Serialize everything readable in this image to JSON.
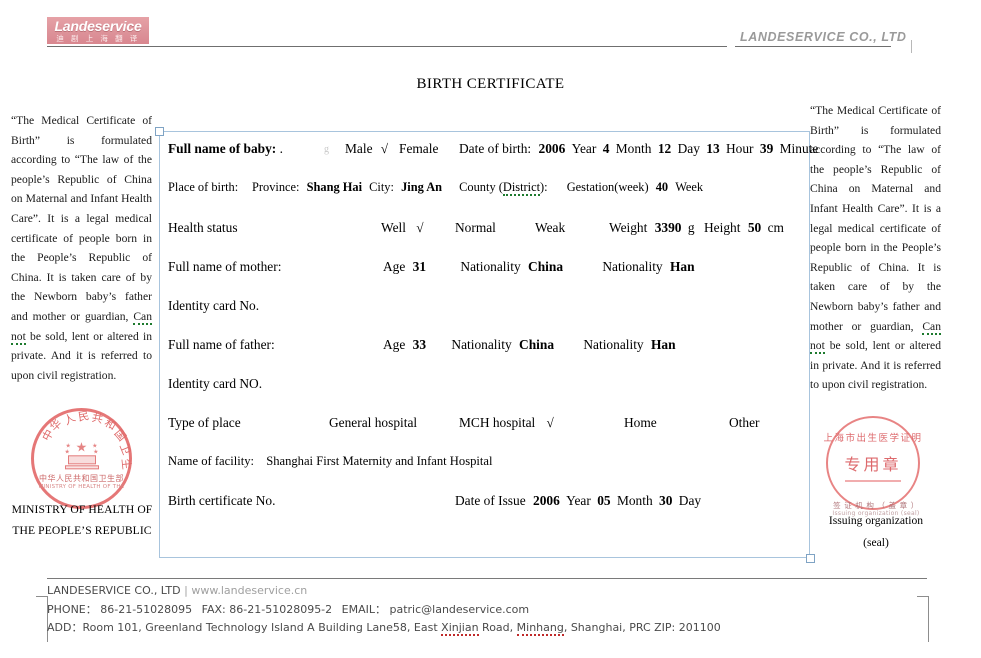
{
  "header": {
    "logo_main": "Landeservice",
    "logo_sub": "迪 剧 上 海 翻 译",
    "brand_right": "LANDESERVICE CO., LTD"
  },
  "title": "BIRTH CERTIFICATE",
  "side_text": {
    "left": "“The Medical Certificate of Birth” is formulated according to “The law of the people’s Republic of China on Maternal and Infant Health Care”. It is a legal medical certificate of people born in the People’s Republic of China. It is taken care of by the Newborn baby’s father and mother or guardian, ",
    "left_error_word": "Can not",
    "left_tail": " be sold, lent or altered in private. And it is referred to upon civil registration.",
    "right": "“The Medical Certificate of Birth” is formulated according to “The law of the people’s Republic of China on Maternal and Infant Health Care”. It is a legal medical certificate of people born in the People’s Republic of China. It is taken care of by the Newborn baby’s father and mother or guardian, ",
    "right_error_word": "Can not",
    "right_tail": " be sold, lent or altered in private. And it is referred to upon civil registration."
  },
  "form": {
    "baby_name_label": "Full name of baby:",
    "baby_name_value": ".",
    "weight_unit_inline": "g",
    "sex_male": "Male",
    "sex_male_checked": "√",
    "sex_female": "Female",
    "dob_label": "Date of birth:",
    "dob_year": "2006",
    "dob_year_unit": "Year",
    "dob_month": "4",
    "dob_month_unit": "Month",
    "dob_day": "12",
    "dob_day_unit": "Day",
    "dob_hour": "13",
    "dob_hour_unit": "Hour",
    "dob_minute": "39",
    "dob_minute_unit": "Minute",
    "place_of_birth_label": "Place of birth:",
    "province_label": "Province:",
    "province_value": "Shang Hai",
    "city_label": "City:",
    "city_value": "Jing An",
    "county_label": "County (",
    "county_error_word": "District",
    "county_label_end": "):",
    "gestation_label": "Gestation(week)",
    "gestation_value": "40",
    "gestation_unit": "Week",
    "health_status_label": "Health status",
    "health_well": "Well",
    "health_well_checked": "√",
    "health_normal": "Normal",
    "health_weak": "Weak",
    "weight_label": "Weight",
    "weight_value": "3390",
    "weight_unit": "g",
    "height_label": "Height",
    "height_value": "50",
    "height_unit": "cm",
    "mother_name_label": "Full name of mother:",
    "mother_age_label": "Age",
    "mother_age_value": "31",
    "mother_nationality_label": "Nationality",
    "mother_nationality_value": "China",
    "mother_ethnicity_label": "Nationality",
    "mother_ethnicity_value": "Han",
    "mother_id_label": "Identity card No.",
    "father_name_label": "Full name of father:",
    "father_age_label": "Age",
    "father_age_value": "33",
    "father_nationality_label": "Nationality",
    "father_nationality_value": "China",
    "father_ethnicity_label": "Nationality",
    "father_ethnicity_value": "Han",
    "father_id_label": "Identity card NO.",
    "type_of_place_label": "Type of place",
    "place_general": "General hospital",
    "place_mch": "MCH hospital",
    "place_mch_checked": "√",
    "place_home": "Home",
    "place_other": "Other",
    "facility_label": "Name of facility:",
    "facility_value": "Shanghai First Maternity and Infant Hospital",
    "cert_no_label": "Birth certificate No.",
    "issue_label": "Date of Issue",
    "issue_year": "2006",
    "issue_year_unit": "Year",
    "issue_month": "05",
    "issue_month_unit": "Month",
    "issue_day": "30",
    "issue_day_unit": "Day"
  },
  "seals": {
    "left_emblem_alt": "prc-national-emblem",
    "left_ring_text": "中华人民共和国卫生部",
    "left_ring_sub": "MINISTRY OF HEALTH OF THE",
    "ministry_line1": "MINISTRY OF HEALTH OF",
    "ministry_line2": "THE PEOPLE’S REPUBLIC",
    "right_arc_text": "上海市出生医学证明",
    "right_center_text": "专用章",
    "right_sub_cn": "签 证 机 构 （ 盖 章 ）",
    "right_sub_en": "Issuing  organization  (seal)",
    "issuing_line1": "Issuing organization",
    "issuing_line2": "(seal)"
  },
  "footer": {
    "company": "LANDESERVICE CO., LTD",
    "separator": "|",
    "website": "www.landeservice.cn",
    "phone_label": "PHONE：",
    "phone": "86-21-51028095",
    "fax_label": "FAX:",
    "fax": "86-21-51028095-2",
    "email_label": "EMAIL：",
    "email": "patric@landeservice.com",
    "address_label": "ADD：",
    "address_part1": "Room 101, Greenland Technology Island A Building Lane58, East ",
    "address_err1": "Xinjian",
    "address_part2": " Road, ",
    "address_err2": "Minhang",
    "address_part3": ", Shanghai, PRC ZIP: 201100"
  },
  "colors": {
    "brand_pink": "#dd939a",
    "seal_red": "#d6494d",
    "textbox_border": "#a8c4dd",
    "spell_green": "#1d7a2e",
    "spell_red": "#c02a2a"
  }
}
